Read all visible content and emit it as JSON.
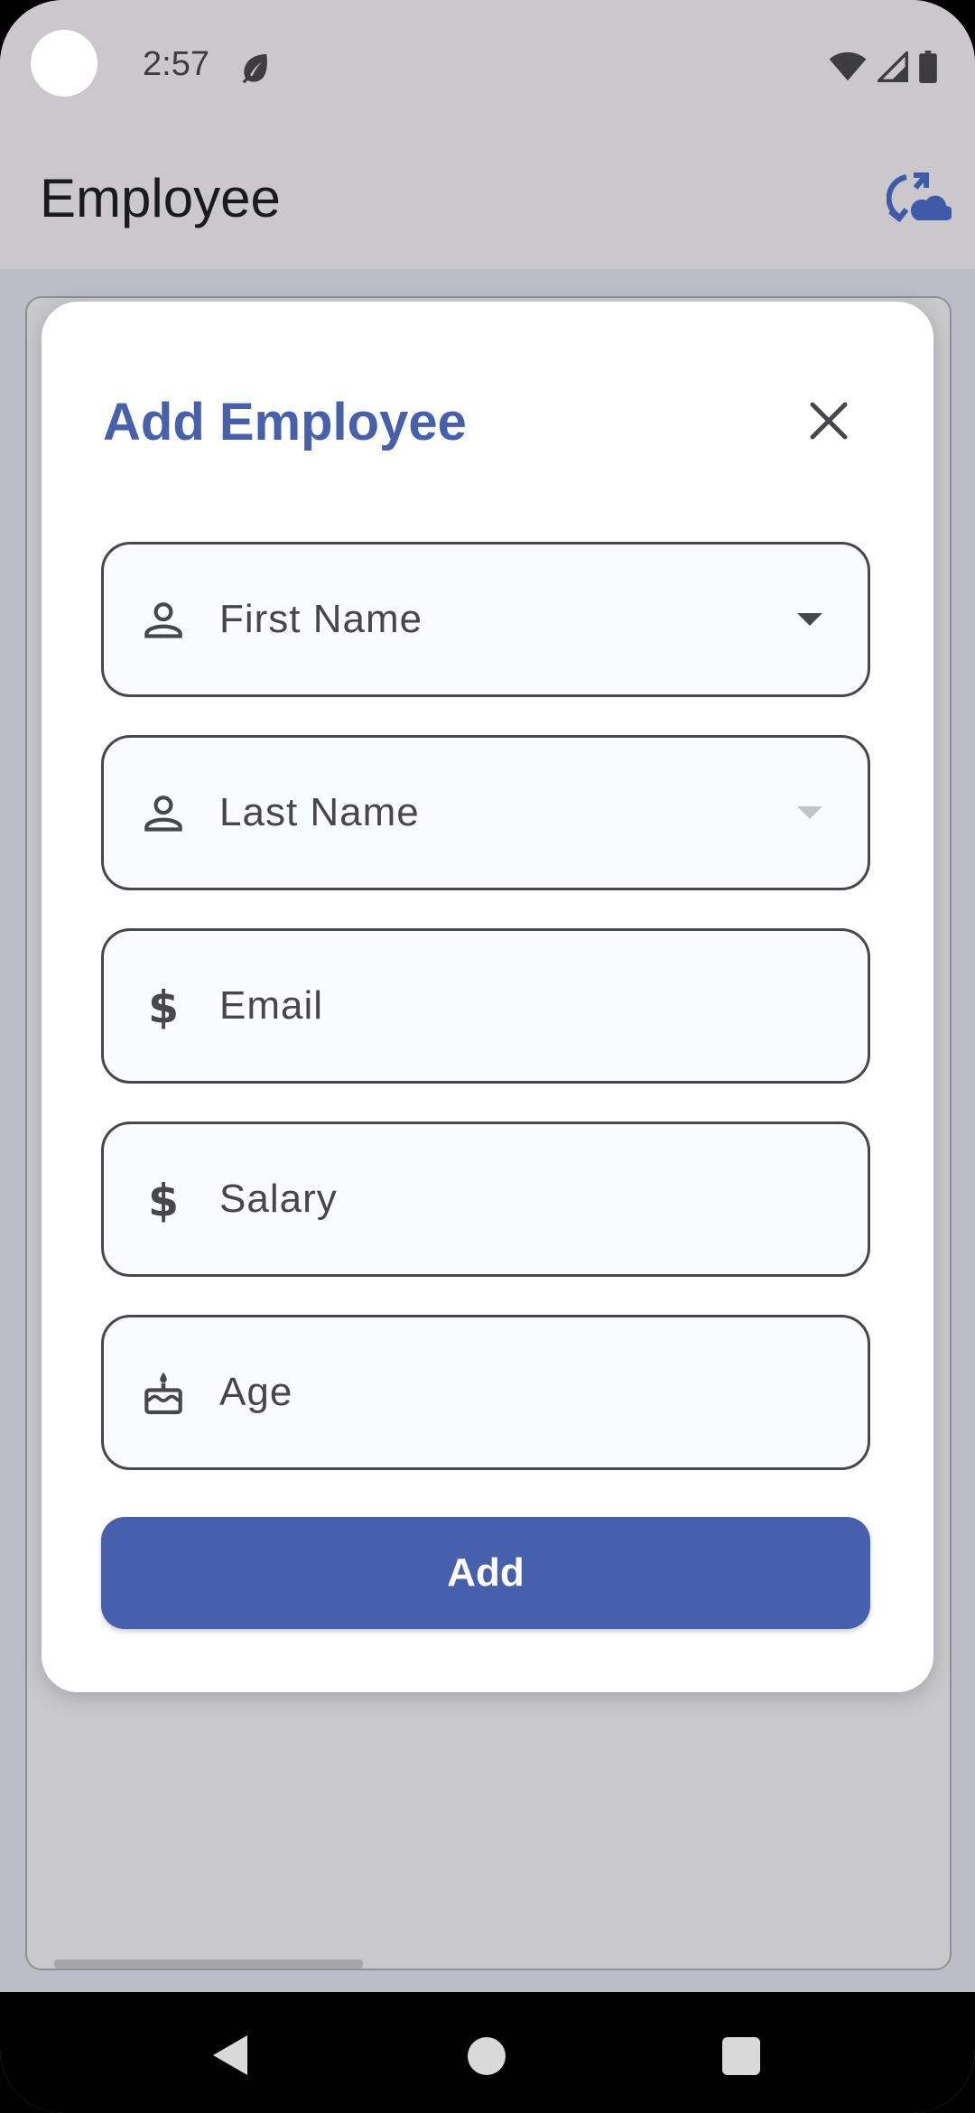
{
  "status_bar": {
    "time": "2:57"
  },
  "app_bar": {
    "title": "Employee"
  },
  "dialog": {
    "title": "Add Employee",
    "fields": {
      "first_name": "First Name",
      "last_name": "Last Name",
      "email": "Email",
      "salary": "Salary",
      "age": "Age"
    },
    "add_label": "Add"
  },
  "colors": {
    "accent": "#4760AD",
    "field_border": "#47474D",
    "field_fill": "#FAFBFE"
  },
  "icons": {
    "first_name": "person-icon",
    "last_name": "person-icon",
    "email": "dollar-icon",
    "salary": "dollar-icon",
    "age": "cake-icon",
    "close": "close-icon",
    "sync": "cloud-sync-icon"
  }
}
